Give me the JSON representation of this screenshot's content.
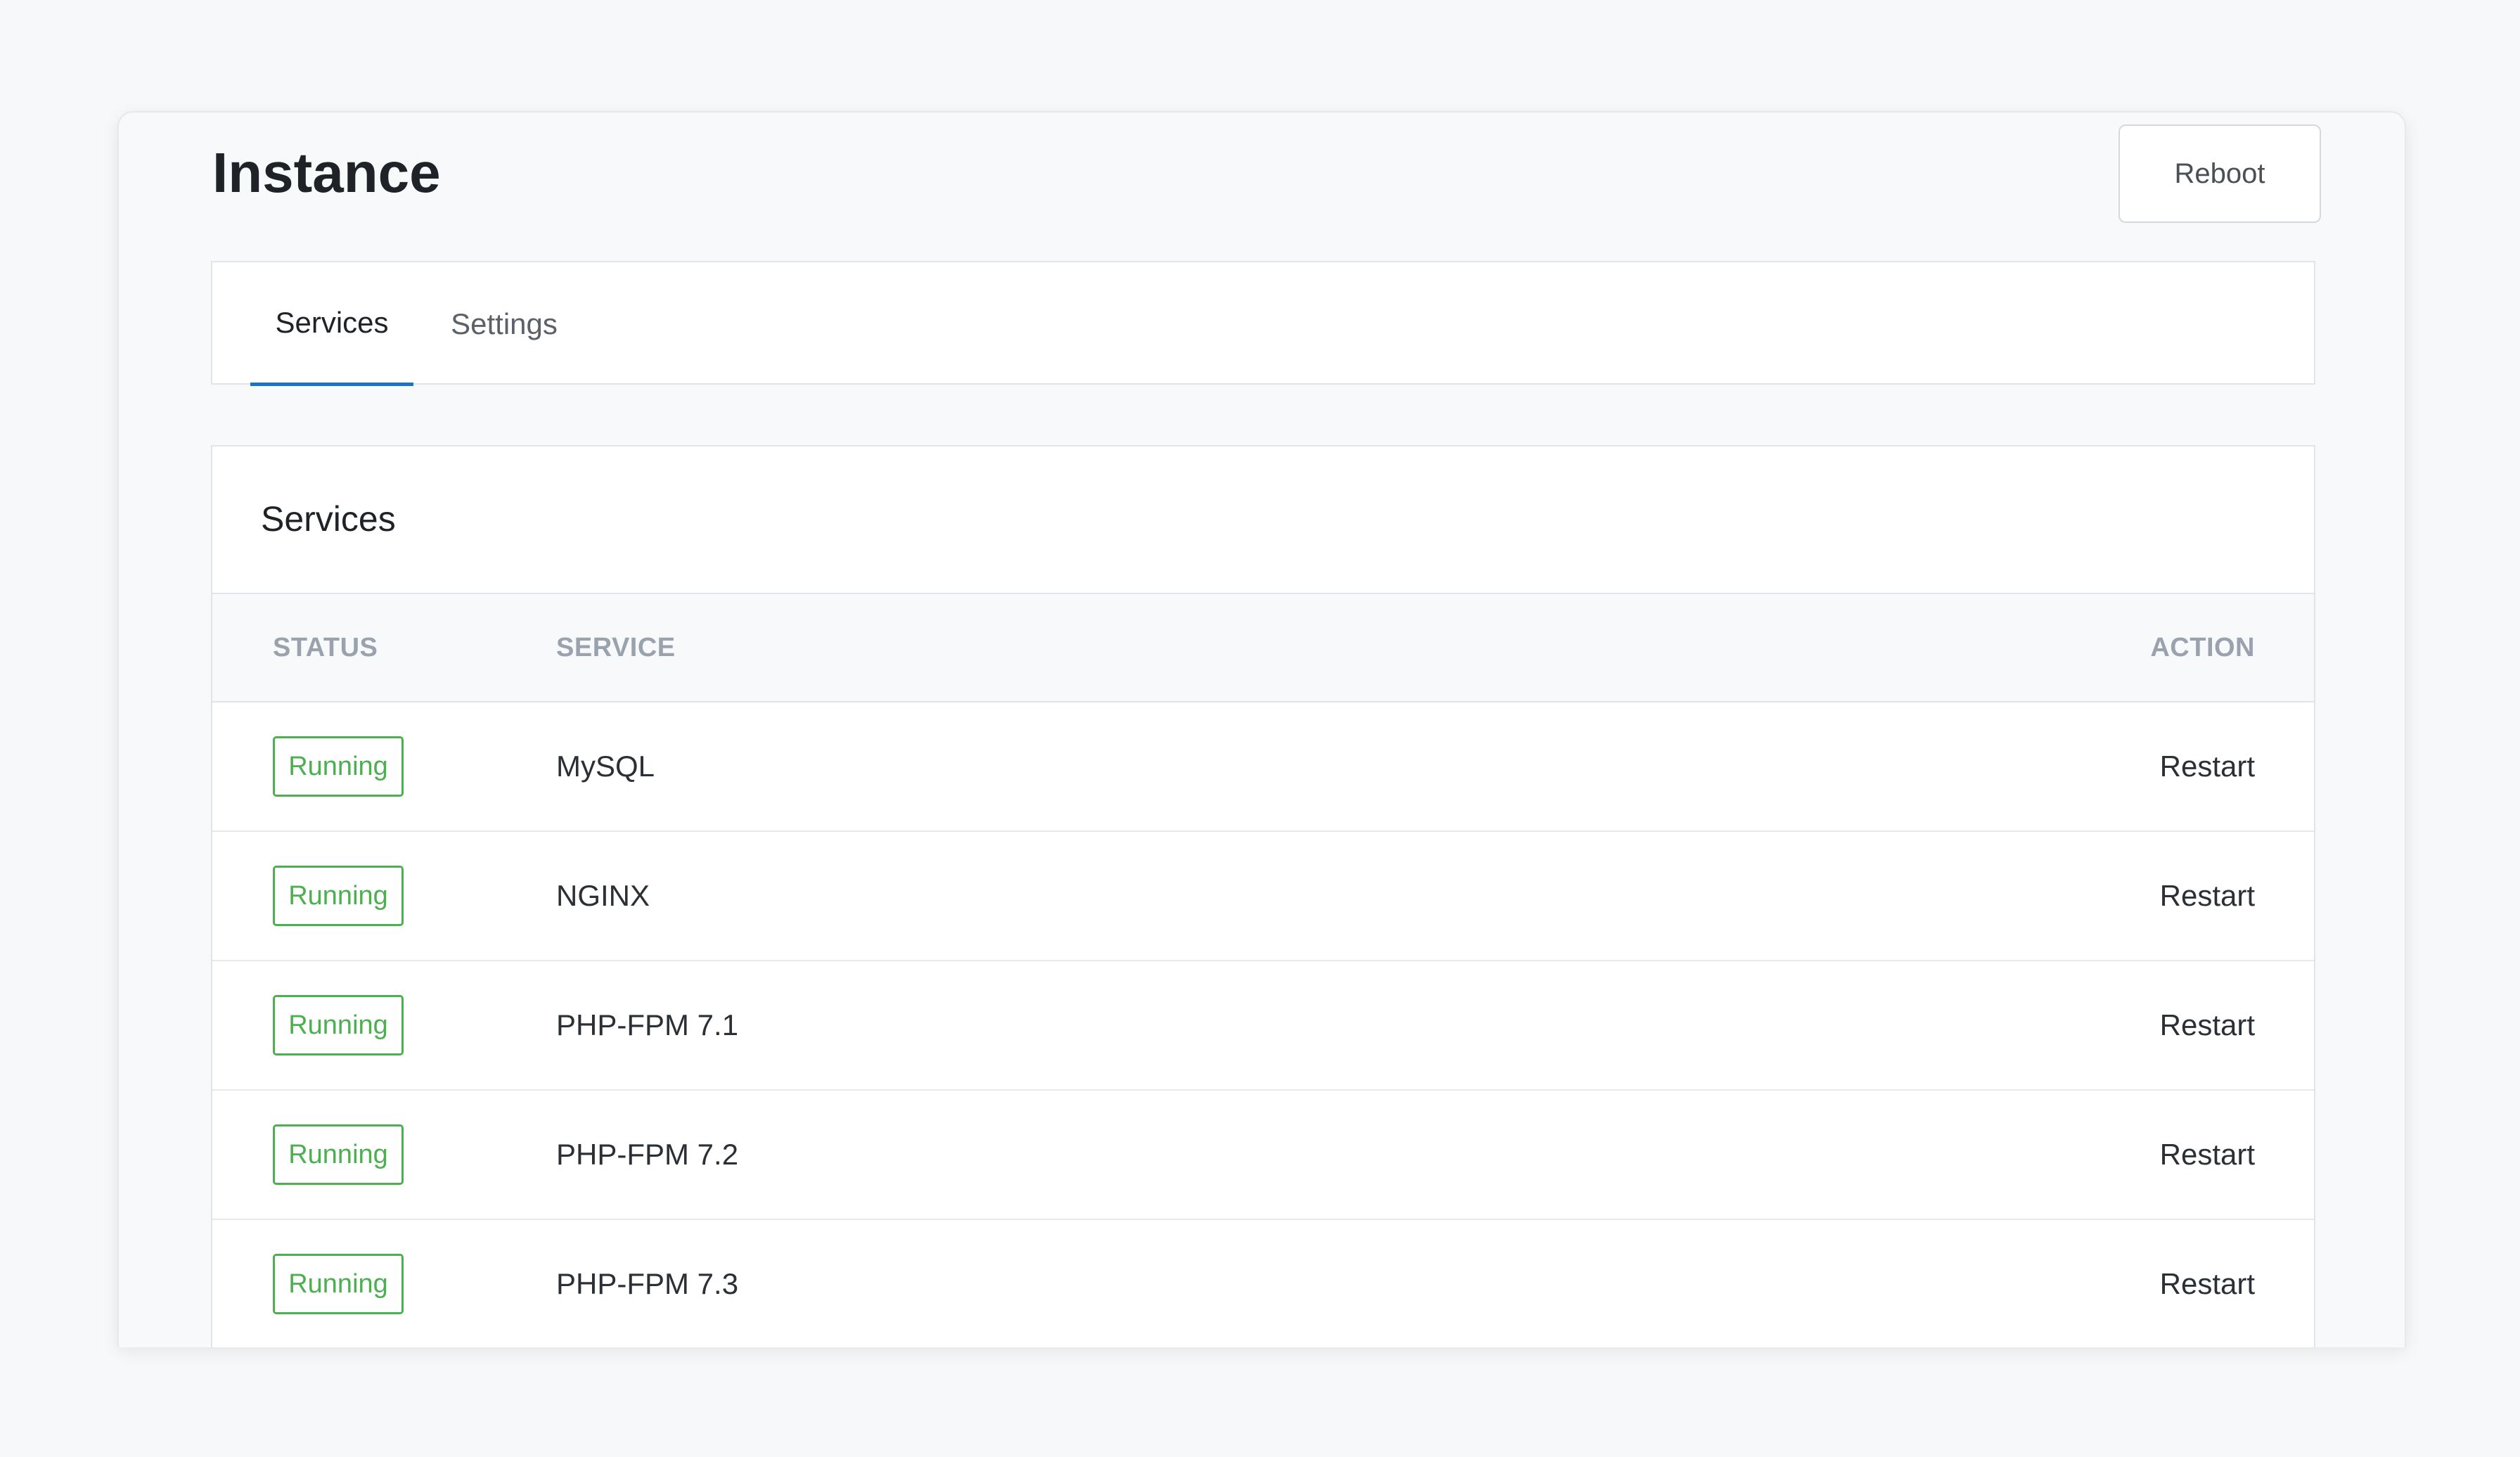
{
  "header": {
    "title": "Instance",
    "reboot_label": "Reboot"
  },
  "tabs": [
    {
      "label": "Services",
      "active": true
    },
    {
      "label": "Settings",
      "active": false
    }
  ],
  "services_card": {
    "title": "Services",
    "columns": {
      "status": "STATUS",
      "service": "SERVICE",
      "action": "ACTION"
    },
    "rows": [
      {
        "status": "Running",
        "service": "MySQL",
        "action": "Restart"
      },
      {
        "status": "Running",
        "service": "NGINX",
        "action": "Restart"
      },
      {
        "status": "Running",
        "service": "PHP-FPM 7.1",
        "action": "Restart"
      },
      {
        "status": "Running",
        "service": "PHP-FPM 7.2",
        "action": "Restart"
      },
      {
        "status": "Running",
        "service": "PHP-FPM 7.3",
        "action": "Restart"
      }
    ]
  },
  "colors": {
    "accent": "#1a73c9",
    "status_running": "#4caf50"
  }
}
